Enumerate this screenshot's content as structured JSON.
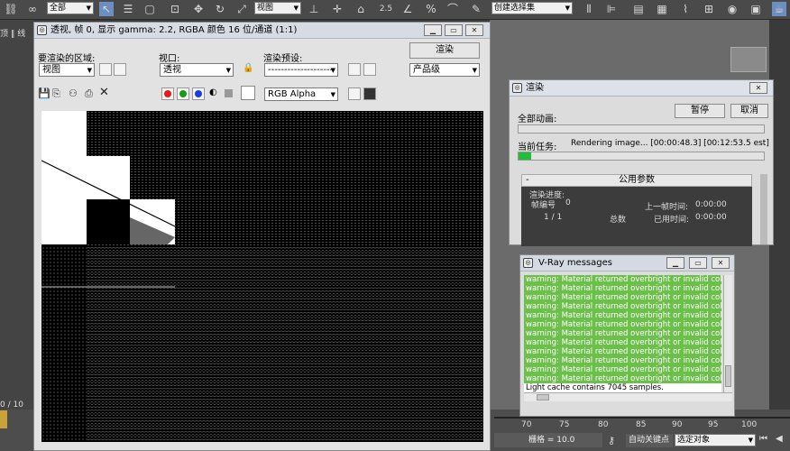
{
  "app_toolbar": {
    "selection_filter": "全部",
    "view_dropdown": "视图",
    "selection_set": "创建选择集",
    "icons": [
      "link-icon",
      "select-icon",
      "move-icon",
      "rotate-icon",
      "scale-icon",
      "snap-icon",
      "angle-snap-icon",
      "percent-snap-icon",
      "spinner-snap-icon",
      "mirror-icon",
      "align-icon",
      "layer-icon",
      "curve-editor-icon",
      "schematic-icon",
      "material-icon",
      "render-setup-icon",
      "render-icon"
    ],
    "angle_value": "2.5"
  },
  "left_panel": {
    "text1": "顶 ‖ 线",
    "frame_counter": "0 / 10"
  },
  "timeline": {
    "ticks": [
      "70",
      "75",
      "80",
      "85",
      "90",
      "95",
      "100"
    ],
    "grid_label": "栅格 = 10.0",
    "autokey_label": "自动关键点",
    "autokey_select": "选定对象"
  },
  "frame_window": {
    "title": "透视, 帧 0, 显示 gamma: 2.2, RGBA 颜色 16 位/通道 (1:1)",
    "area_label": "要渲染的区域:",
    "area_value": "视图",
    "viewport_label": "视口:",
    "viewport_value": "透视",
    "preset_label": "渲染预设:",
    "preset_value": "--------------------",
    "render_button": "渲染",
    "quality_value": "产品级",
    "channel_value": "RGB Alpha",
    "colors": {
      "red": "#e31b1b",
      "green": "#1a9a1a",
      "blue": "#1b3fd6"
    }
  },
  "render_dialog": {
    "title": "渲染",
    "total_anim_label": "全部动画:",
    "pause_button": "暂停",
    "cancel_button": "取消",
    "current_task_label": "当前任务:",
    "current_task_text": "Rendering image... [00:00:48.3] [00:12:53.5 est]",
    "task_progress": 0.05,
    "rollout_title": "公用参数",
    "rollout_collapse": "-",
    "progress_group": "渲染进度:",
    "frame_label": "帧编号",
    "frame_value": "0",
    "last_frame_label": "上一帧时间:",
    "last_frame_value": "0:00:00",
    "count_value": "1 / 1",
    "total_label": "总数",
    "elapsed_label": "已用时间:",
    "elapsed_value": "0:00:00"
  },
  "vray_window": {
    "title": "V-Ray messages",
    "messages": [
      "warning: Material returned overbright or invalid color (object '",
      "warning: Material returned overbright or invalid color (object '",
      "warning: Material returned overbright or invalid color (object '",
      "warning: Material returned overbright or invalid color (object '",
      "warning: Material returned overbright or invalid color (object '",
      "warning: Material returned overbright or invalid color (object '",
      "warning: Material returned overbright or invalid color (object '",
      "warning: Material returned overbright or invalid color (object '",
      "warning: Material returned overbright or invalid color (object '",
      "warning: Material returned overbright or invalid color (object '",
      "warning: Material returned overbright or invalid color (object '",
      "warning: Material returned overbright or invalid color (object '"
    ],
    "info_line": "Light cache contains 7045 samples.",
    "warning_color": "#6cbf4a"
  }
}
